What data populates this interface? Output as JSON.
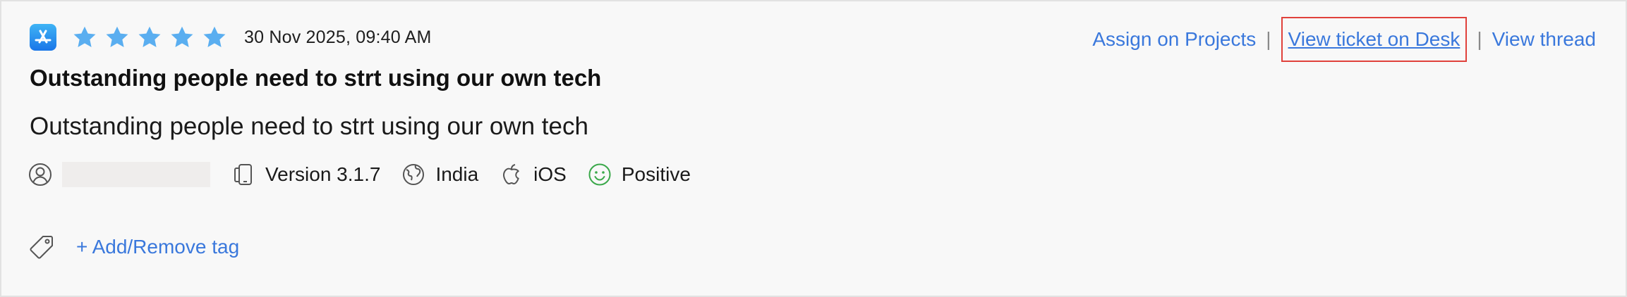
{
  "review": {
    "rating": 5,
    "max_rating": 5,
    "date": "30 Nov 2025, 09:40 AM",
    "title": "Outstanding people need to strt using our own tech",
    "body": "Outstanding people need to strt using our own tech"
  },
  "actions": {
    "assign_label": "Assign on Projects",
    "view_ticket_label": "View ticket on Desk",
    "view_thread_label": "View thread",
    "separator": "|"
  },
  "meta": {
    "version": "Version 3.1.7",
    "country": "India",
    "platform": "iOS",
    "sentiment": "Positive"
  },
  "tags": {
    "add_remove_label": "+ Add/Remove tag"
  },
  "colors": {
    "star": "#5aaef0",
    "link": "#3a78dc",
    "highlight_border": "#e0413b",
    "positive": "#3aa84a"
  },
  "icons": {
    "source": "app-store-icon",
    "user": "user-icon",
    "device": "device-icon",
    "globe": "globe-icon",
    "apple": "apple-icon",
    "sentiment": "smiley-icon",
    "tag": "tag-icon"
  }
}
